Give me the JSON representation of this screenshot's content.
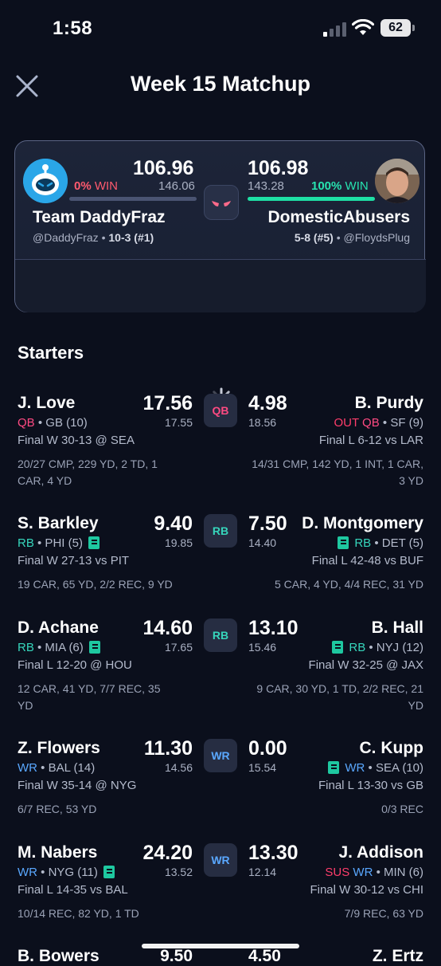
{
  "status": {
    "time": "1:58",
    "battery": "62"
  },
  "header": {
    "title": "Week 15 Matchup"
  },
  "matchup": {
    "left": {
      "score": "106.96",
      "projected": "146.06",
      "win_pct": "0%",
      "win_label": "WIN",
      "team": "Team DaddyFraz",
      "handle": "@DaddyFraz",
      "record": "10-3 (#1)",
      "win_prob": 0.0
    },
    "right": {
      "score": "106.98",
      "projected": "143.28",
      "win_pct": "100%",
      "win_label": "WIN",
      "team": "DomesticAbusers",
      "record": "5-8 (#5)",
      "handle": "@FloydsPlug",
      "win_prob": 1.0
    }
  },
  "starters_title": "Starters",
  "players": [
    {
      "slot": "QB",
      "left": {
        "name": "J. Love",
        "status": "",
        "pos": "QB",
        "team_rank": "• GB (10)",
        "news": false,
        "game": "Final W 30-13 @ SEA",
        "stats": "20/27 CMP, 229 YD, 2 TD, 1 CAR, 4 YD",
        "score": "17.56",
        "proj": "17.55"
      },
      "right": {
        "name": "B. Purdy",
        "status": "OUT",
        "pos": "QB",
        "team_rank": "• SF (9)",
        "news": false,
        "game": "Final L 6-12 vs LAR",
        "stats": "14/31 CMP, 142 YD, 1 INT, 1 CAR, 3 YD",
        "score": "4.98",
        "proj": "18.56"
      }
    },
    {
      "slot": "RB",
      "left": {
        "name": "S. Barkley",
        "status": "",
        "pos": "RB",
        "team_rank": "• PHI (5)",
        "news": true,
        "game": "Final W 27-13 vs PIT",
        "stats": "19 CAR, 65 YD, 2/2 REC, 9 YD",
        "score": "9.40",
        "proj": "19.85"
      },
      "right": {
        "name": "D. Montgomery",
        "status": "",
        "pos": "RB",
        "team_rank": "• DET (5)",
        "news": true,
        "game": "Final L 42-48 vs BUF",
        "stats": "5 CAR, 4 YD, 4/4 REC, 31 YD",
        "score": "7.50",
        "proj": "14.40"
      }
    },
    {
      "slot": "RB",
      "left": {
        "name": "D. Achane",
        "status": "",
        "pos": "RB",
        "team_rank": "• MIA (6)",
        "news": true,
        "game": "Final L 12-20 @ HOU",
        "stats": "12 CAR, 41 YD, 7/7 REC, 35 YD",
        "score": "14.60",
        "proj": "17.65"
      },
      "right": {
        "name": "B. Hall",
        "status": "",
        "pos": "RB",
        "team_rank": "• NYJ (12)",
        "news": true,
        "game": "Final W 32-25 @ JAX",
        "stats": "9 CAR, 30 YD, 1 TD, 2/2 REC, 21 YD",
        "score": "13.10",
        "proj": "15.46"
      }
    },
    {
      "slot": "WR",
      "left": {
        "name": "Z. Flowers",
        "status": "",
        "pos": "WR",
        "team_rank": "• BAL (14)",
        "news": false,
        "game": "Final W 35-14 @ NYG",
        "stats": "6/7 REC, 53 YD",
        "score": "11.30",
        "proj": "14.56"
      },
      "right": {
        "name": "C. Kupp",
        "status": "",
        "pos": "WR",
        "team_rank": "• SEA (10)",
        "news": true,
        "game": "Final L 13-30 vs GB",
        "stats": "0/3 REC",
        "score": "0.00",
        "proj": "15.54"
      }
    },
    {
      "slot": "WR",
      "left": {
        "name": "M. Nabers",
        "status": "",
        "pos": "WR",
        "team_rank": "• NYG (11)",
        "news": true,
        "game": "Final L 14-35 vs BAL",
        "stats": "10/14 REC, 82 YD, 1 TD",
        "score": "24.20",
        "proj": "13.52"
      },
      "right": {
        "name": "J. Addison",
        "status": "SUS",
        "pos": "WR",
        "team_rank": "• MIN (6)",
        "news": false,
        "game": "Final W 30-12 vs CHI",
        "stats": "7/9 REC, 63 YD",
        "score": "13.30",
        "proj": "12.14"
      }
    }
  ],
  "peek": {
    "left_name": "B. Bowers",
    "left_score": "9.50",
    "right_score": "4.50",
    "right_name": "Z. Ertz"
  },
  "colors": {
    "background": "#0b0f1c",
    "qb": "#ff4a82",
    "rb": "#36d6bc",
    "wr": "#5aa8ff",
    "win_green": "#1ee0a5",
    "loss_red": "#ff5a6e"
  }
}
